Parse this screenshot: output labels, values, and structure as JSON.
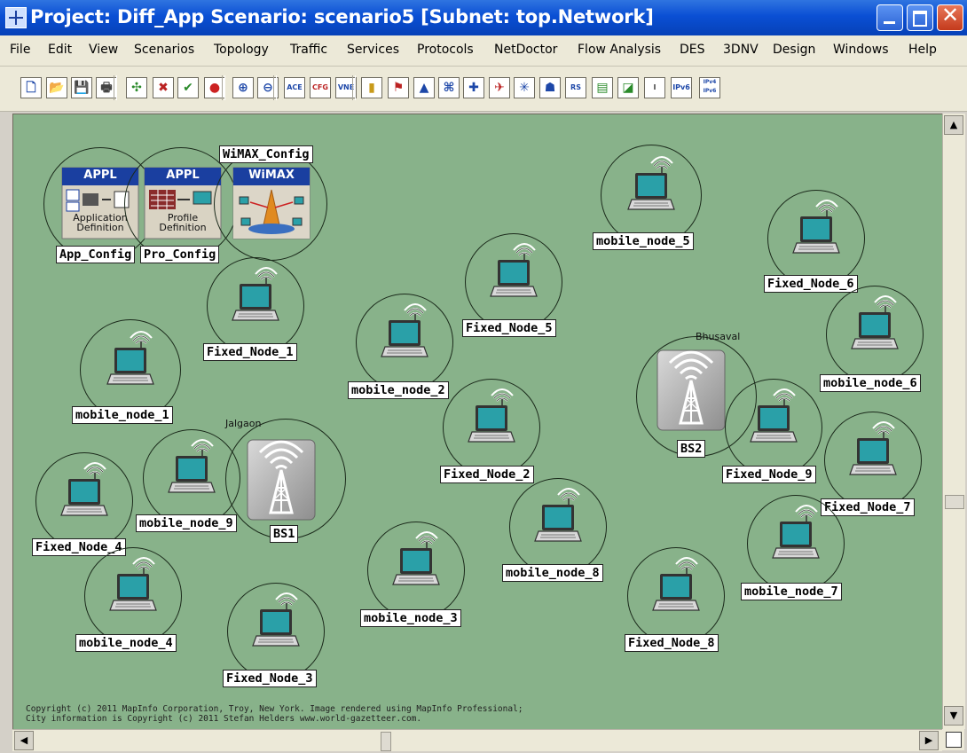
{
  "window": {
    "title": "Project: Diff_App Scenario: scenario5  [Subnet: top.Network]",
    "minimize_label": "minimize",
    "maximize_label": "maximize",
    "close_label": "close"
  },
  "menu": [
    "File",
    "Edit",
    "View",
    "Scenarios",
    "Topology",
    "Traffic",
    "Services",
    "Protocols",
    "NetDoctor",
    "Flow Analysis",
    "DES",
    "3DNV",
    "Design",
    "Windows",
    "Help"
  ],
  "toolbar": [
    {
      "name": "new-icon"
    },
    {
      "name": "open-icon"
    },
    {
      "name": "save-icon"
    },
    {
      "name": "print-icon"
    },
    {
      "name": "rapid-config-icon"
    },
    {
      "name": "fail-node-icon"
    },
    {
      "name": "recover-node-icon"
    },
    {
      "name": "object-palette-icon"
    },
    {
      "name": "zoom-in-icon"
    },
    {
      "name": "zoom-out-icon"
    },
    {
      "name": "import-ace-icon",
      "text": "ACE"
    },
    {
      "name": "import-cfg-icon",
      "text": "CFG"
    },
    {
      "name": "import-vne-icon",
      "text": "VNE"
    },
    {
      "name": "traffic-light-icon"
    },
    {
      "name": "configure-run-des-icon"
    },
    {
      "name": "view-results-icon"
    },
    {
      "name": "flow-analysis-icon"
    },
    {
      "name": "netdoctor-icon"
    },
    {
      "name": "deploy-wizard-icon"
    },
    {
      "name": "link-sweep-icon"
    },
    {
      "name": "network-view-icon"
    },
    {
      "name": "rs-icon",
      "text": "RS"
    },
    {
      "name": "report-icon"
    },
    {
      "name": "graph-icon"
    },
    {
      "name": "info-icon",
      "text": "I"
    },
    {
      "name": "ipv6-icon",
      "text": "IPv6"
    },
    {
      "name": "ipv4-ipv6-icon",
      "text": "IPv4 IPv6"
    }
  ],
  "config_objects": [
    {
      "label": "App_Config",
      "badge": "APPL",
      "caption": "Application Definition"
    },
    {
      "label": "Pro_Config",
      "badge": "APPL",
      "caption": "Profile Definition"
    },
    {
      "label": "WiMAX_Config",
      "badge": "WiMAX",
      "caption": ""
    }
  ],
  "base_stations": [
    {
      "label": "BS1",
      "city": "Jalgaon"
    },
    {
      "label": "BS2",
      "city": "Bhusaval"
    }
  ],
  "nodes": [
    {
      "label": "mobile_node_5"
    },
    {
      "label": "Fixed_Node_6"
    },
    {
      "label": "Fixed_Node_5"
    },
    {
      "label": "Fixed_Node_1"
    },
    {
      "label": "mobile_node_6"
    },
    {
      "label": "mobile_node_2"
    },
    {
      "label": "mobile_node_1"
    },
    {
      "label": "Fixed_Node_2"
    },
    {
      "label": "Fixed_Node_9"
    },
    {
      "label": "Fixed_Node_7"
    },
    {
      "label": "mobile_node_9"
    },
    {
      "label": "Fixed_Node_4"
    },
    {
      "label": "mobile_node_8"
    },
    {
      "label": "mobile_node_7"
    },
    {
      "label": "mobile_node_3"
    },
    {
      "label": "mobile_node_4"
    },
    {
      "label": "Fixed_Node_8"
    },
    {
      "label": "Fixed_Node_3"
    }
  ],
  "copyright": {
    "line1": "Copyright (c) 2011 MapInfo Corporation, Troy, New York. Image rendered using MapInfo Professional;",
    "line2": "City information is Copyright (c) 2011 Stefan Helders www.world-gazetteer.com."
  },
  "colors": {
    "canvas": "#88b28a",
    "title_bar": "#0a4fd4",
    "screen": "#2aa0a8"
  }
}
